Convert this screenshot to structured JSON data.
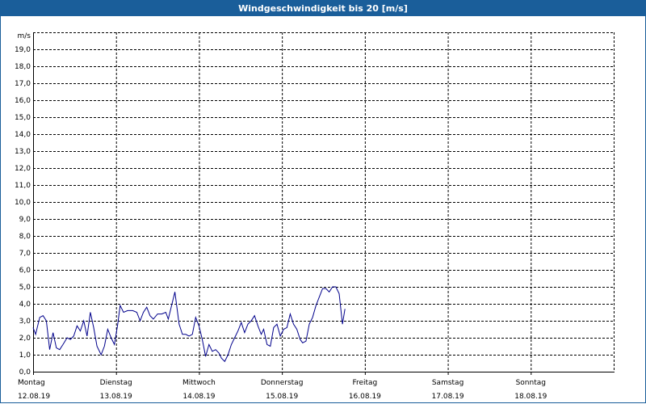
{
  "window": {
    "title": "Windgeschwindigkeit bis 20 [m/s]"
  },
  "colors": {
    "title_bar": "#1a5e9a",
    "series": "#00008b",
    "grid": "#000000"
  },
  "chart_data": {
    "type": "line",
    "title": "Windgeschwindigkeit bis 20 [m/s]",
    "ylabel": "m/s",
    "xlabel": "",
    "ylim": [
      0,
      20
    ],
    "xlim": [
      0,
      7
    ],
    "grid": true,
    "y_ticks": [
      "0,0",
      "1,0",
      "2,0",
      "3,0",
      "4,0",
      "5,0",
      "6,0",
      "7,0",
      "8,0",
      "9,0",
      "10,0",
      "11,0",
      "12,0",
      "13,0",
      "14,0",
      "15,0",
      "16,0",
      "17,0",
      "18,0",
      "19,0"
    ],
    "x_ticks": [
      {
        "day": "Montag",
        "date": "12.08.19"
      },
      {
        "day": "Dienstag",
        "date": "13.08.19"
      },
      {
        "day": "Mittwoch",
        "date": "14.08.19"
      },
      {
        "day": "Donnerstag",
        "date": "15.08.19"
      },
      {
        "day": "Freitag",
        "date": "16.08.19"
      },
      {
        "day": "Samstag",
        "date": "17.08.19"
      },
      {
        "day": "Sonntag",
        "date": "18.08.19"
      }
    ],
    "series": [
      {
        "values": [
          [
            0.0,
            2.6
          ],
          [
            0.03,
            2.2
          ],
          [
            0.08,
            3.2
          ],
          [
            0.12,
            3.3
          ],
          [
            0.16,
            3.0
          ],
          [
            0.2,
            1.3
          ],
          [
            0.24,
            2.3
          ],
          [
            0.28,
            1.4
          ],
          [
            0.32,
            1.3
          ],
          [
            0.36,
            1.6
          ],
          [
            0.41,
            2.0
          ],
          [
            0.45,
            1.9
          ],
          [
            0.49,
            2.1
          ],
          [
            0.53,
            2.7
          ],
          [
            0.57,
            2.4
          ],
          [
            0.61,
            3.0
          ],
          [
            0.65,
            2.1
          ],
          [
            0.69,
            3.5
          ],
          [
            0.73,
            2.6
          ],
          [
            0.77,
            1.5
          ],
          [
            0.82,
            1.0
          ],
          [
            0.86,
            1.5
          ],
          [
            0.9,
            2.5
          ],
          [
            0.94,
            2.0
          ],
          [
            0.98,
            1.6
          ],
          [
            1.02,
            2.8
          ],
          [
            1.05,
            3.9
          ],
          [
            1.09,
            3.5
          ],
          [
            1.14,
            3.6
          ],
          [
            1.2,
            3.6
          ],
          [
            1.25,
            3.5
          ],
          [
            1.29,
            3.0
          ],
          [
            1.33,
            3.5
          ],
          [
            1.37,
            3.8
          ],
          [
            1.41,
            3.3
          ],
          [
            1.45,
            3.1
          ],
          [
            1.5,
            3.4
          ],
          [
            1.55,
            3.4
          ],
          [
            1.6,
            3.5
          ],
          [
            1.63,
            3.1
          ],
          [
            1.67,
            3.9
          ],
          [
            1.71,
            4.7
          ],
          [
            1.76,
            2.8
          ],
          [
            1.8,
            2.2
          ],
          [
            1.84,
            2.2
          ],
          [
            1.88,
            2.1
          ],
          [
            1.92,
            2.2
          ],
          [
            1.96,
            3.2
          ],
          [
            2.0,
            2.7
          ],
          [
            2.04,
            1.9
          ],
          [
            2.08,
            0.9
          ],
          [
            2.12,
            1.6
          ],
          [
            2.16,
            1.2
          ],
          [
            2.2,
            1.3
          ],
          [
            2.24,
            1.1
          ],
          [
            2.27,
            0.8
          ],
          [
            2.31,
            0.6
          ],
          [
            2.35,
            1.0
          ],
          [
            2.39,
            1.6
          ],
          [
            2.43,
            2.0
          ],
          [
            2.47,
            2.4
          ],
          [
            2.51,
            2.9
          ],
          [
            2.55,
            2.3
          ],
          [
            2.59,
            2.8
          ],
          [
            2.63,
            3.0
          ],
          [
            2.67,
            3.3
          ],
          [
            2.71,
            2.7
          ],
          [
            2.75,
            2.2
          ],
          [
            2.78,
            2.5
          ],
          [
            2.82,
            1.6
          ],
          [
            2.86,
            1.5
          ],
          [
            2.9,
            2.6
          ],
          [
            2.94,
            2.8
          ],
          [
            2.98,
            2.1
          ],
          [
            3.02,
            2.5
          ],
          [
            3.06,
            2.6
          ],
          [
            3.1,
            3.4
          ],
          [
            3.14,
            2.8
          ],
          [
            3.18,
            2.5
          ],
          [
            3.22,
            1.9
          ],
          [
            3.25,
            1.7
          ],
          [
            3.29,
            1.8
          ],
          [
            3.33,
            2.8
          ],
          [
            3.37,
            3.2
          ],
          [
            3.41,
            3.9
          ],
          [
            3.45,
            4.4
          ],
          [
            3.49,
            4.9
          ],
          [
            3.53,
            4.9
          ],
          [
            3.57,
            4.7
          ],
          [
            3.61,
            5.0
          ],
          [
            3.65,
            5.0
          ],
          [
            3.69,
            4.6
          ],
          [
            3.73,
            2.8
          ],
          [
            3.76,
            3.7
          ]
        ]
      }
    ]
  }
}
